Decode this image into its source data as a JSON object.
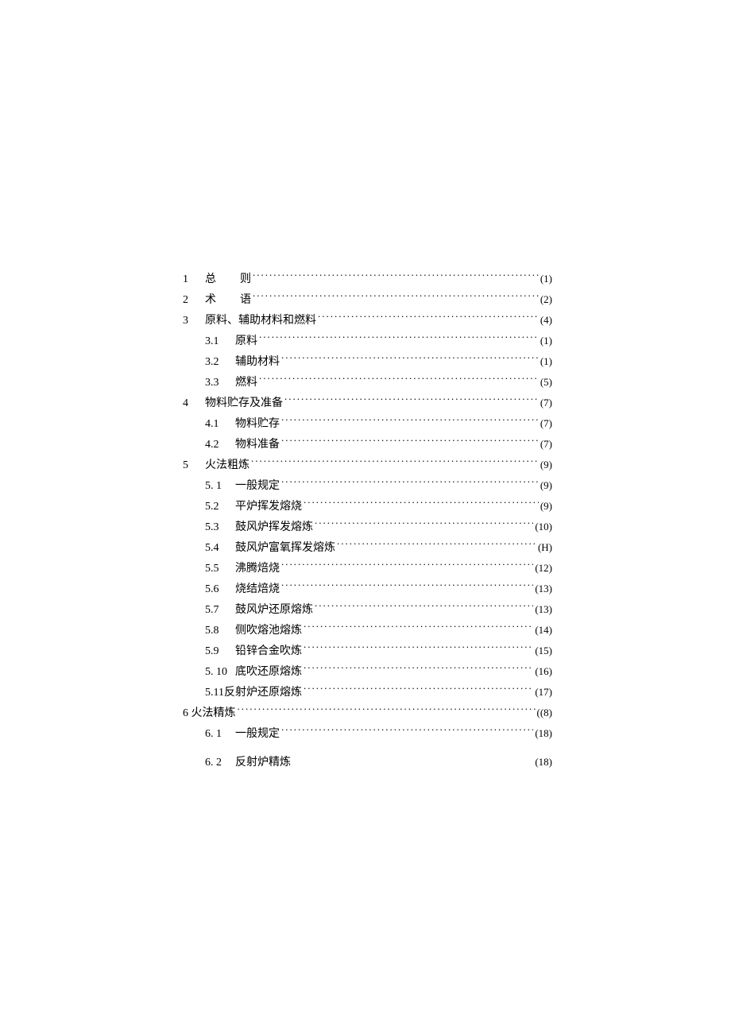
{
  "toc": [
    {
      "level": 1,
      "num": "1",
      "title": "总",
      "title2": "则",
      "page": "(1)",
      "gap": true
    },
    {
      "level": 1,
      "num": "2",
      "title": "术",
      "title2": "语",
      "page": "(2)",
      "gap": true
    },
    {
      "level": 1,
      "num": "3",
      "title": "原料、辅助材料和燃料",
      "page": "(4)"
    },
    {
      "level": 2,
      "num": "3.1",
      "title": "原料",
      "page": "(1)"
    },
    {
      "level": 2,
      "num": "3.2",
      "title": "辅助材料",
      "page": "(1)"
    },
    {
      "level": 2,
      "num": "3.3",
      "title": "燃料",
      "page": "(5)"
    },
    {
      "level": 1,
      "num": "4",
      "title": "物料贮存及准备",
      "page": "(7)"
    },
    {
      "level": 2,
      "num": "4.1",
      "title": "物料贮存",
      "page": "(7)"
    },
    {
      "level": 2,
      "num": "4.2",
      "title": "物料准备",
      "page": "(7)"
    },
    {
      "level": 1,
      "num": "5",
      "title": "火法粗炼",
      "page": "(9)"
    },
    {
      "level": 2,
      "num": "5. 1",
      "title": "一般规定",
      "page": "(9)"
    },
    {
      "level": 2,
      "num": "5.2",
      "title": "平炉挥发熔烧",
      "page": "(9)"
    },
    {
      "level": 2,
      "num": "5.3",
      "title": "鼓风炉挥发熔炼",
      "page": "(10)"
    },
    {
      "level": 2,
      "num": "5.4",
      "title": "鼓风炉富氧挥发熔炼",
      "page": "(H)"
    },
    {
      "level": 2,
      "num": "5.5",
      "title": "沸腾焙烧",
      "page": "(12)"
    },
    {
      "level": 2,
      "num": "5.6",
      "title": "烧结焙烧",
      "page": "(13)"
    },
    {
      "level": 2,
      "num": "5.7",
      "title": "鼓风炉还原熔炼",
      "page": "(13)"
    },
    {
      "level": 2,
      "num": "5.8",
      "title": "侧吹熔池熔炼",
      "page": "(14)"
    },
    {
      "level": 2,
      "num": "5.9",
      "title": "铅锌合金吹炼",
      "page": "(15)"
    },
    {
      "level": 2,
      "num": "5. 10",
      "title": "底吹还原熔炼",
      "page": "(16)"
    },
    {
      "level": 2,
      "num": "",
      "title": "5.11反射炉还原熔炼",
      "page": "(17)",
      "inline": true
    },
    {
      "level": 1,
      "num": "",
      "title": "6 火法精炼",
      "page": "((8)",
      "inline": true,
      "top": true
    },
    {
      "level": 2,
      "num": "6. 1",
      "title": "一般规定",
      "page": "(18)"
    },
    {
      "level": 2,
      "num": "6. 2",
      "title": "反射炉精炼",
      "page": "(18)",
      "nodots": true,
      "spaced": true
    }
  ]
}
